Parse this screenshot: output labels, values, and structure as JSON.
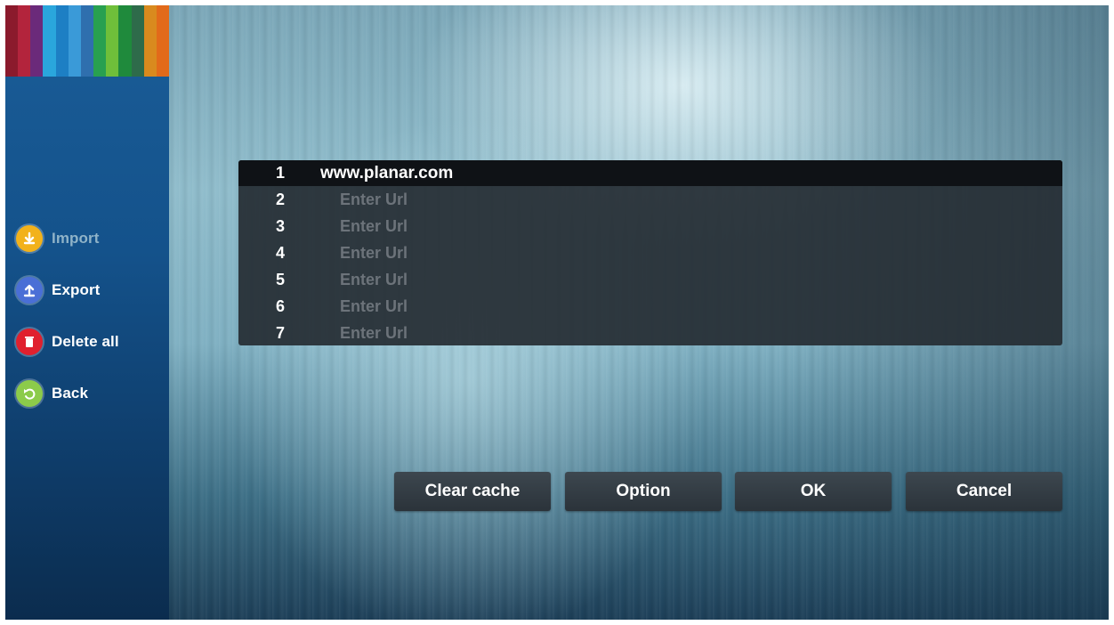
{
  "sidebar": {
    "strip_colors": [
      "#8b1a2c",
      "#b3243c",
      "#6b2a7a",
      "#2aa6dc",
      "#1d7fc4",
      "#3a9ad8",
      "#2f6fae",
      "#28a050",
      "#6fbf3a",
      "#1f8a3c",
      "#2e6b4a",
      "#d98a1e",
      "#e26a1a"
    ],
    "items": [
      {
        "label": "Import",
        "icon": "download-icon",
        "color": "#f2b21b"
      },
      {
        "label": "Export",
        "icon": "upload-icon",
        "color": "#4a6fd6"
      },
      {
        "label": "Delete all",
        "icon": "trash-icon",
        "color": "#e0202e"
      },
      {
        "label": "Back",
        "icon": "back-icon",
        "color": "#8ccb4a"
      }
    ]
  },
  "url_list": {
    "rows": [
      {
        "num": "1",
        "value": "www.planar.com",
        "selected": true
      },
      {
        "num": "2",
        "placeholder": "Enter Url"
      },
      {
        "num": "3",
        "placeholder": "Enter Url"
      },
      {
        "num": "4",
        "placeholder": "Enter Url"
      },
      {
        "num": "5",
        "placeholder": "Enter Url"
      },
      {
        "num": "6",
        "placeholder": "Enter Url"
      },
      {
        "num": "7",
        "placeholder": "Enter Url"
      }
    ]
  },
  "buttons": {
    "clear_cache": "Clear cache",
    "option": "Option",
    "ok": "OK",
    "cancel": "Cancel"
  }
}
